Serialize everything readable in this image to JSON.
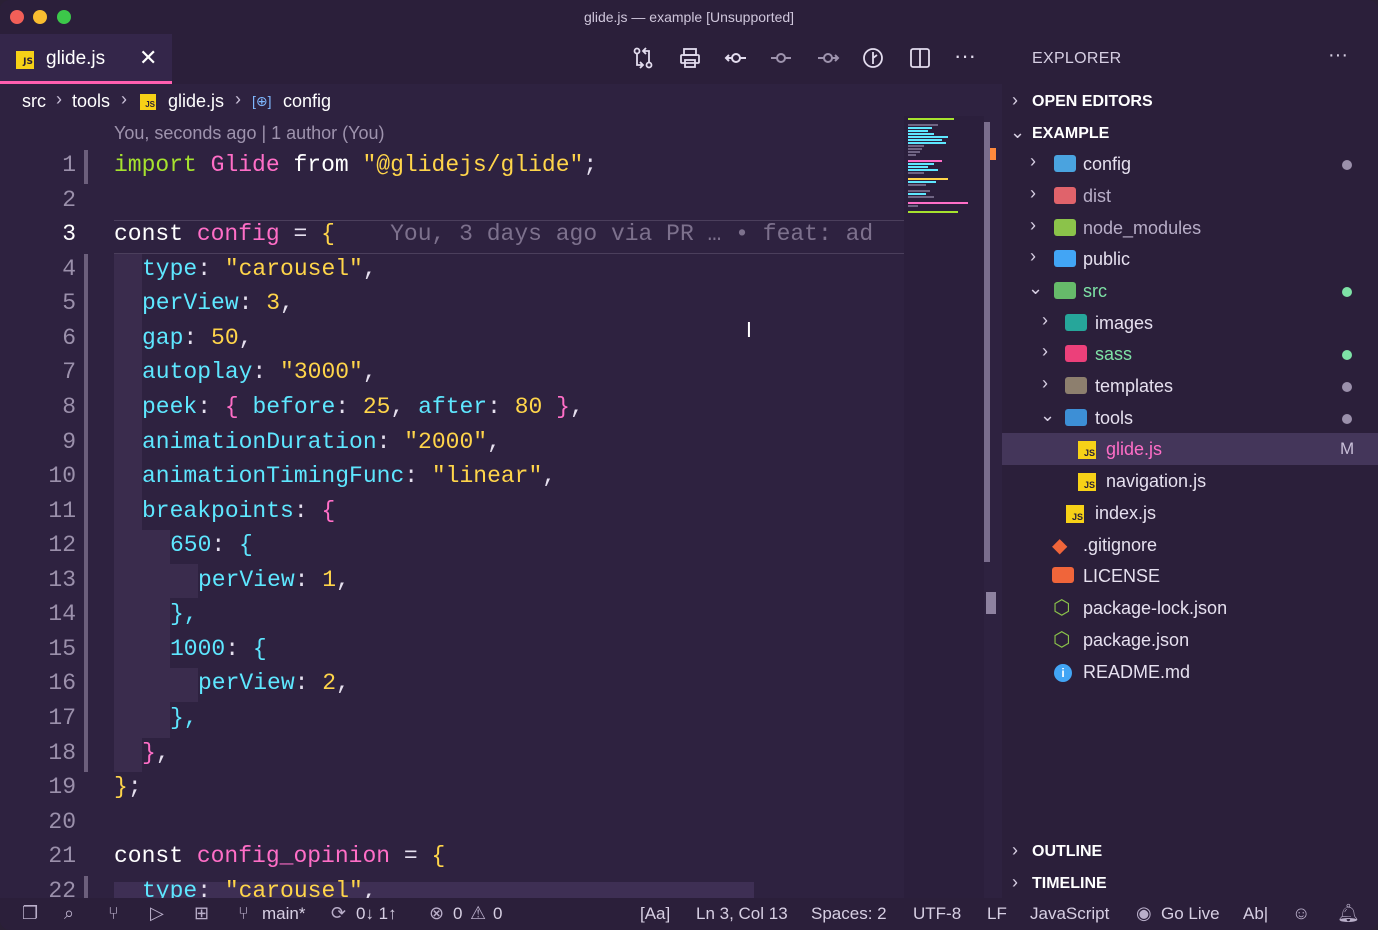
{
  "window": {
    "title": "glide.js — example [Unsupported]"
  },
  "tab": {
    "icon": "JS",
    "label": "glide.js",
    "close": "✕"
  },
  "toolbar": {
    "icons": [
      "git-compare-icon",
      "print-icon",
      "git-commit-icon",
      "git-commit-prev-icon",
      "git-commit-next-icon",
      "timeline-icon",
      "split-editor-icon",
      "more-actions-icon"
    ]
  },
  "breadcrumb": {
    "items": [
      "src",
      "tools",
      "glide.js",
      "config"
    ],
    "js_badge": "JS"
  },
  "editor": {
    "blame_header": "You, seconds ago | 1 author (You)",
    "ghost_blame": "You, 3 days ago via PR … • feat: ad",
    "line_numbers": [
      "1",
      "2",
      "3",
      "4",
      "5",
      "6",
      "7",
      "8",
      "9",
      "10",
      "11",
      "12",
      "13",
      "14",
      "15",
      "16",
      "17",
      "18",
      "19",
      "20",
      "21",
      "22"
    ],
    "active_line": "3",
    "lines": {
      "l1": {
        "kw": "import",
        "name": "Glide",
        "from": "from",
        "str": "\"@glidejs/glide\"",
        "end": ";"
      },
      "l3": {
        "kw": "const",
        "name": "config",
        "eq": " = ",
        "brace": "{"
      },
      "l4": {
        "prop": "type",
        "sep": ": ",
        "val": "\"carousel\"",
        "end": ","
      },
      "l5": {
        "prop": "perView",
        "sep": ": ",
        "val": "3",
        "end": ","
      },
      "l6": {
        "prop": "gap",
        "sep": ": ",
        "val": "50",
        "end": ","
      },
      "l7": {
        "prop": "autoplay",
        "sep": ": ",
        "val": "\"3000\"",
        "end": ","
      },
      "l8": {
        "prop": "peek",
        "sep": ": ",
        "open": "{ ",
        "p1": "before",
        "v1": "25",
        "p2": "after",
        "v2": "80",
        "close": " }",
        "end": ","
      },
      "l9": {
        "prop": "animationDuration",
        "sep": ": ",
        "val": "\"2000\"",
        "end": ","
      },
      "l10": {
        "prop": "animationTimingFunc",
        "sep": ": ",
        "val": "\"linear\"",
        "end": ","
      },
      "l11": {
        "prop": "breakpoints",
        "sep": ": ",
        "brace": "{"
      },
      "l12": {
        "prop": "650",
        "sep": ": ",
        "brace": "{"
      },
      "l13": {
        "prop": "perView",
        "sep": ": ",
        "val": "1",
        "end": ","
      },
      "l14": {
        "text": "},"
      },
      "l15": {
        "prop": "1000",
        "sep": ": ",
        "brace": "{"
      },
      "l16": {
        "prop": "perView",
        "sep": ": ",
        "val": "2",
        "end": ","
      },
      "l17": {
        "text": "},"
      },
      "l18": {
        "brace": "}",
        "end": ","
      },
      "l19": {
        "brace": "}",
        "end": ";"
      },
      "l21": {
        "kw": "const",
        "name": "config_opinion",
        "eq": " = ",
        "brace": "{"
      },
      "l22": {
        "prop": "type",
        "sep": ": ",
        "val": "\"carousel\"",
        "end": ","
      }
    }
  },
  "sidebar": {
    "title": "EXPLORER",
    "more": "···",
    "sections": {
      "open_editors": "OPEN EDITORS",
      "example": "EXAMPLE",
      "outline": "OUTLINE",
      "timeline": "TIMELINE"
    },
    "tree": [
      {
        "label": "config",
        "badge": ""
      },
      {
        "label": "dist",
        "badge": ""
      },
      {
        "label": "node_modules",
        "badge": ""
      },
      {
        "label": "public",
        "badge": ""
      },
      {
        "label": "src",
        "badge": ""
      },
      {
        "label": "images",
        "badge": ""
      },
      {
        "label": "sass",
        "badge": ""
      },
      {
        "label": "templates",
        "badge": ""
      },
      {
        "label": "tools",
        "badge": ""
      },
      {
        "label": "glide.js",
        "badge": "M"
      },
      {
        "label": "navigation.js",
        "badge": ""
      },
      {
        "label": "index.js",
        "badge": ""
      },
      {
        "label": ".gitignore",
        "badge": ""
      },
      {
        "label": "LICENSE",
        "badge": ""
      },
      {
        "label": "package-lock.json",
        "badge": ""
      },
      {
        "label": "package.json",
        "badge": ""
      },
      {
        "label": "README.md",
        "badge": ""
      }
    ]
  },
  "statusbar": {
    "branch": "main*",
    "sync": "0↓ 1↑",
    "errors": "0",
    "warnings": "0",
    "match_case": "[Aa]",
    "position": "Ln 3, Col 13",
    "spaces": "Spaces: 2",
    "encoding": "UTF-8",
    "eol": "LF",
    "language": "JavaScript",
    "go_live": "Go Live",
    "abl": "Ab|"
  },
  "colors": {
    "accent": "#ff5fb0",
    "keyword": "#a6e22e",
    "variable": "#ff6ec7",
    "property": "#5ee7ff",
    "string": "#ffd54a",
    "modified_dot": "#7ee2a6",
    "untracked_dot": "#9b90ab"
  }
}
